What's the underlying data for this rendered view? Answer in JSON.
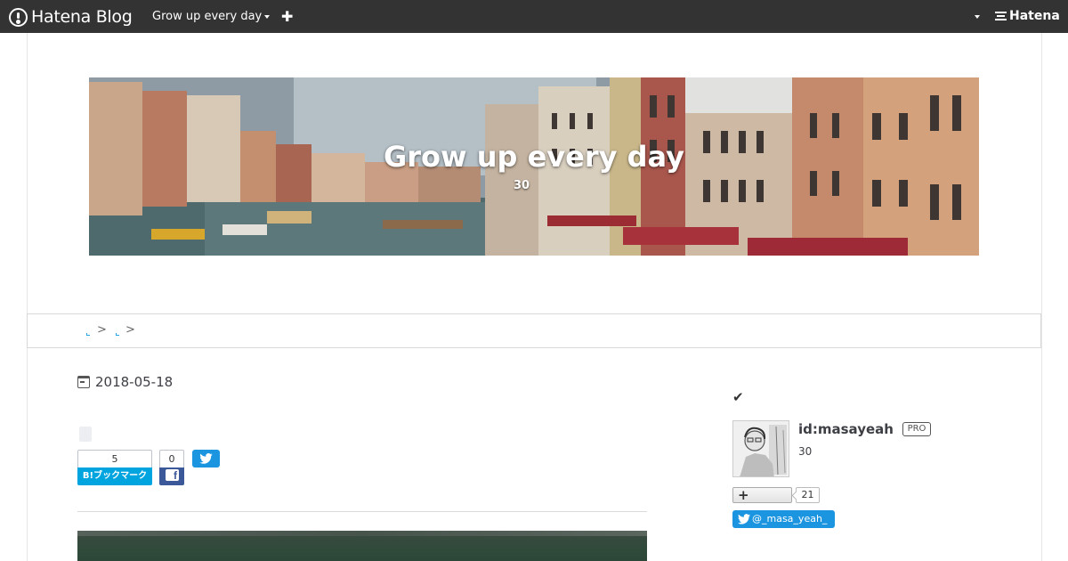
{
  "topbar": {
    "brand": "Hatena Blog",
    "blog_name": "Grow up every day",
    "add_icon": "plus-icon",
    "hatena": "Hatena"
  },
  "header": {
    "title": "Grow up every day",
    "subtitle": "30"
  },
  "breadcrumb": {
    "separators": [
      ">",
      ">"
    ]
  },
  "article": {
    "date": "2018-05-18",
    "hatebu_count": "5",
    "hatebu_label": "B!ブックマーク",
    "facebook_count": "0"
  },
  "sidebar": {
    "user_id": "id:masayeah",
    "badge": "PRO",
    "description": "30",
    "readers_count": "21",
    "twitter_handle": "@_masa_yeah_"
  },
  "colors": {
    "topbar": "#333333",
    "hatebu": "#00a4de",
    "facebook": "#3b5998",
    "twitter": "#1b95e0"
  }
}
